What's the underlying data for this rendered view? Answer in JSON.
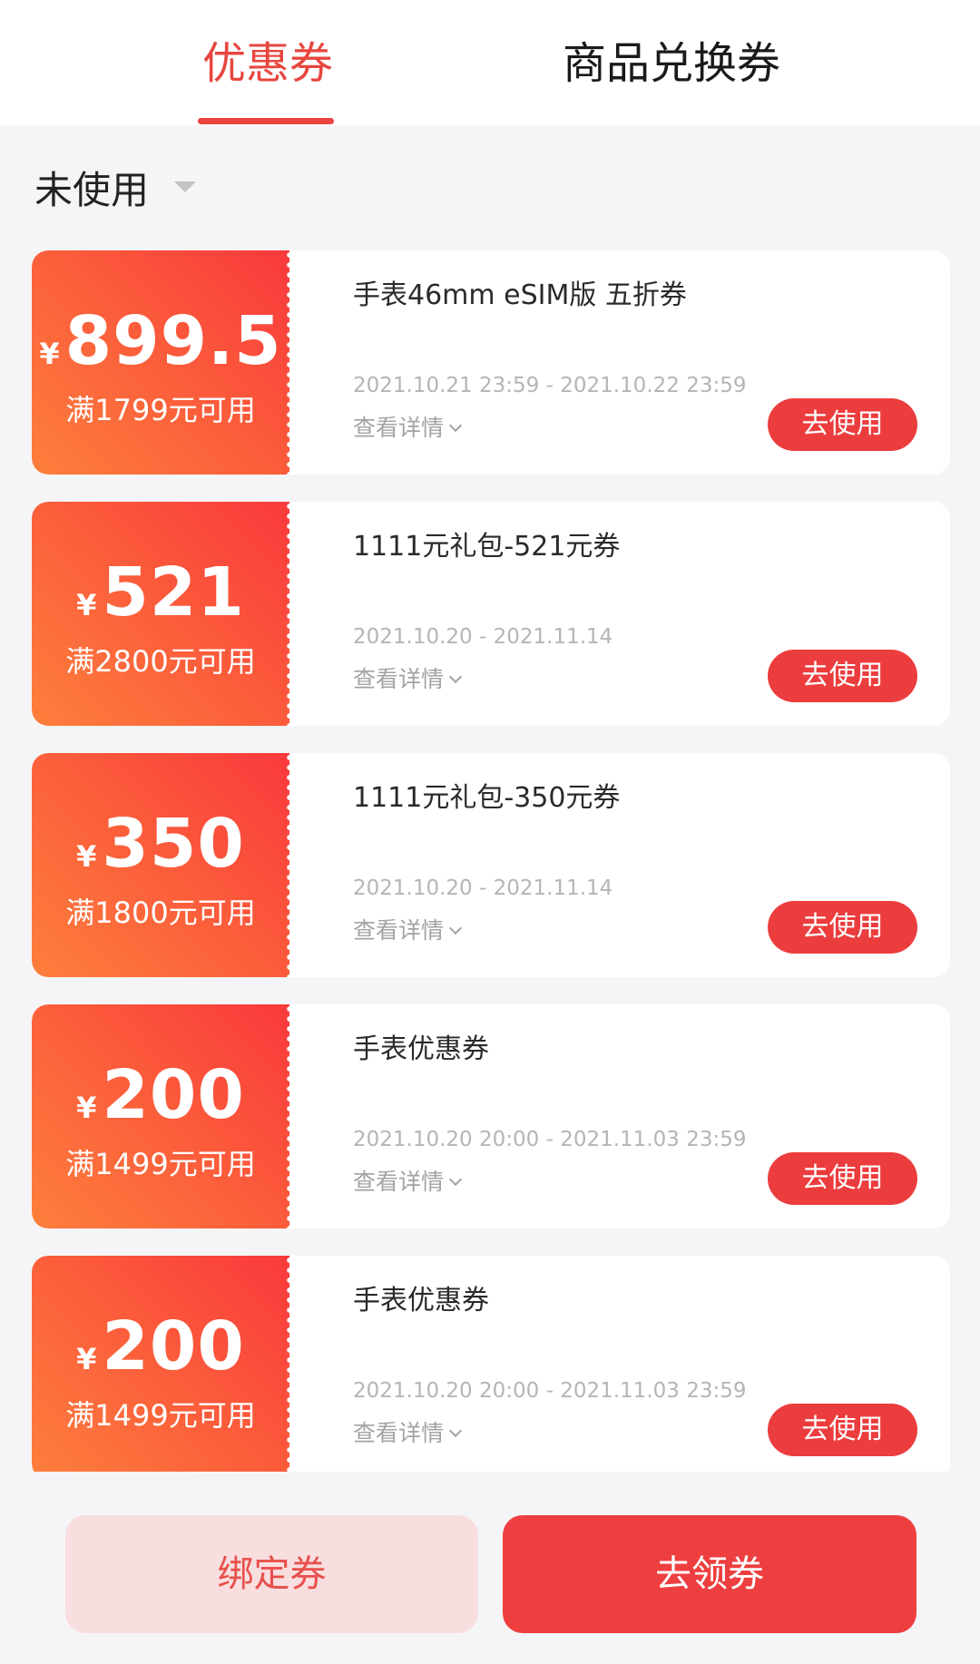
{
  "tabs": [
    {
      "label": "优惠券",
      "active": true
    },
    {
      "label": "商品兑换券",
      "active": false
    }
  ],
  "filter": {
    "selected": "未使用"
  },
  "currency_symbol": "¥",
  "coupons": [
    {
      "amount": "899.5",
      "threshold": "满1799元可用",
      "title": "手表46mm eSIM版 五折券",
      "period": "2021.10.21 23:59 - 2021.10.22 23:59",
      "details_label": "查看详情",
      "action_label": "去使用"
    },
    {
      "amount": "521",
      "threshold": "满2800元可用",
      "title": "1111元礼包-521元券",
      "period": "2021.10.20 - 2021.11.14",
      "details_label": "查看详情",
      "action_label": "去使用"
    },
    {
      "amount": "350",
      "threshold": "满1800元可用",
      "title": "1111元礼包-350元券",
      "period": "2021.10.20 - 2021.11.14",
      "details_label": "查看详情",
      "action_label": "去使用"
    },
    {
      "amount": "200",
      "threshold": "满1499元可用",
      "title": "手表优惠券",
      "period": "2021.10.20 20:00 - 2021.11.03 23:59",
      "details_label": "查看详情",
      "action_label": "去使用"
    },
    {
      "amount": "200",
      "threshold": "满1499元可用",
      "title": "手表优惠券",
      "period": "2021.10.20 20:00 - 2021.11.03 23:59",
      "details_label": "查看详情",
      "action_label": "去使用"
    }
  ],
  "bottom": {
    "bind_label": "绑定券",
    "get_label": "去领券"
  },
  "colors": {
    "accent": "#e84440",
    "coupon_gradient_start": "#f9393c",
    "coupon_gradient_end": "#fd7f3c",
    "bind_bg": "#f8dedf"
  }
}
